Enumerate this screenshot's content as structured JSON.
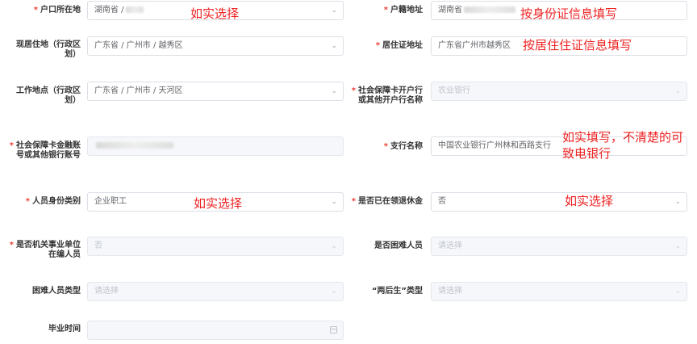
{
  "form": {
    "hukou_location": {
      "label": "户口所在地",
      "required": true,
      "value_prefix": "湖南省 / ",
      "annotation": "如实选择"
    },
    "native_address": {
      "label": "户籍地址",
      "required": true,
      "value_prefix": "湖南省",
      "annotation": "按身份证信息填写"
    },
    "current_residence": {
      "label": "现居住地（行政区划）",
      "required": false,
      "value": "广东省 / 广州市 / 越秀区"
    },
    "residence_permit_address": {
      "label": "居住证地址",
      "required": true,
      "value": "广东省广州市越秀区",
      "annotation": "按居住住证信息填写"
    },
    "work_location": {
      "label": "工作地点（行政区划）",
      "required": false,
      "value": "广东省 / 广州市 / 天河区"
    },
    "bank_name": {
      "label": "社会保障卡开户行或其他开户行名称",
      "required": true,
      "value": "农业银行"
    },
    "bank_account": {
      "label": "社会保障卡金融账号或其他银行账号",
      "required": true,
      "value": ""
    },
    "branch_name": {
      "label": "支行名称",
      "required": true,
      "value": "中国农业银行广州林和西路支行",
      "annotation": "如实填写，不清楚的可致电银行"
    },
    "identity_type": {
      "label": "人员身份类别",
      "required": true,
      "value": "企业职工",
      "annotation": "如实选择"
    },
    "retired": {
      "label": "是否已在领退休金",
      "required": true,
      "value": "否",
      "annotation": "如实选择"
    },
    "public_institution": {
      "label": "是否机关事业单位在编人员",
      "required": true,
      "value": "否"
    },
    "hardship": {
      "label": "是否困难人员",
      "required": false,
      "placeholder": "请选择"
    },
    "hardship_type": {
      "label": "困难人员类型",
      "required": false,
      "placeholder": "请选择"
    },
    "two_later_type": {
      "label": "“两后生”类型",
      "required": false,
      "placeholder": "请选择"
    },
    "graduation_time": {
      "label": "毕业时间",
      "required": false,
      "value": ""
    }
  },
  "required_mark": "*",
  "icons": {
    "select": "chevron-down-icon",
    "date": "calendar-icon"
  },
  "colors": {
    "annotation": "#ee2222",
    "required": "#f04134",
    "border": "#dcdfe6",
    "disabled_bg": "#f5f7fa"
  }
}
